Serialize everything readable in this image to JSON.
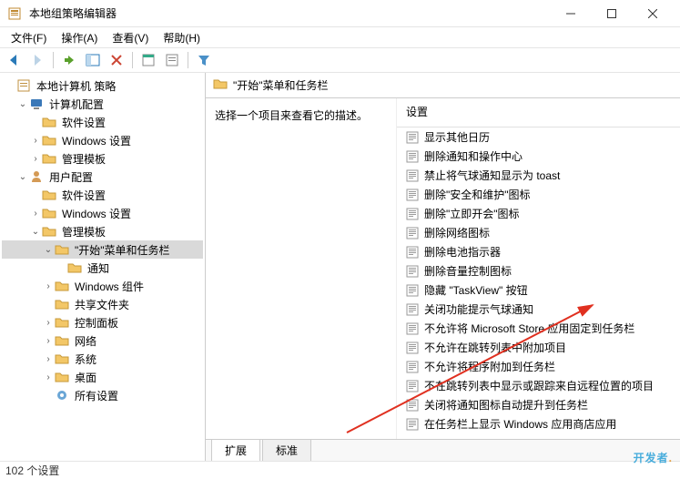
{
  "window": {
    "title": "本地组策略编辑器"
  },
  "menu": {
    "file": "文件(F)",
    "action": "操作(A)",
    "view": "查看(V)",
    "help": "帮助(H)"
  },
  "tree": {
    "root": "本地计算机 策略",
    "computer": "计算机配置",
    "c_software": "软件设置",
    "c_windows": "Windows 设置",
    "c_admin": "管理模板",
    "user": "用户配置",
    "u_software": "软件设置",
    "u_windows": "Windows 设置",
    "u_admin": "管理模板",
    "start_taskbar": "\"开始\"菜单和任务栏",
    "notifications": "通知",
    "win_components": "Windows 组件",
    "shared_folders": "共享文件夹",
    "control_panel": "控制面板",
    "network": "网络",
    "system": "系统",
    "desktop": "桌面",
    "all_settings": "所有设置"
  },
  "detail": {
    "heading": "\"开始\"菜单和任务栏",
    "description_hint": "选择一个项目来查看它的描述。",
    "column_header": "设置",
    "items": [
      "显示其他日历",
      "删除通知和操作中心",
      "禁止将气球通知显示为 toast",
      "删除\"安全和维护\"图标",
      "删除\"立即开会\"图标",
      "删除网络图标",
      "删除电池指示器",
      "删除音量控制图标",
      "隐藏 \"TaskView\" 按钮",
      "关闭功能提示气球通知",
      "不允许将 Microsoft Store 应用固定到任务栏",
      "不允许在跳转列表中附加项目",
      "不允许将程序附加到任务栏",
      "不在跳转列表中显示或跟踪来自远程位置的项目",
      "关闭将通知图标自动提升到任务栏",
      "在任务栏上显示 Windows 应用商店应用"
    ]
  },
  "tabs": {
    "extended": "扩展",
    "standard": "标准"
  },
  "status": {
    "count": "102 个设置"
  },
  "watermark": "开发者"
}
